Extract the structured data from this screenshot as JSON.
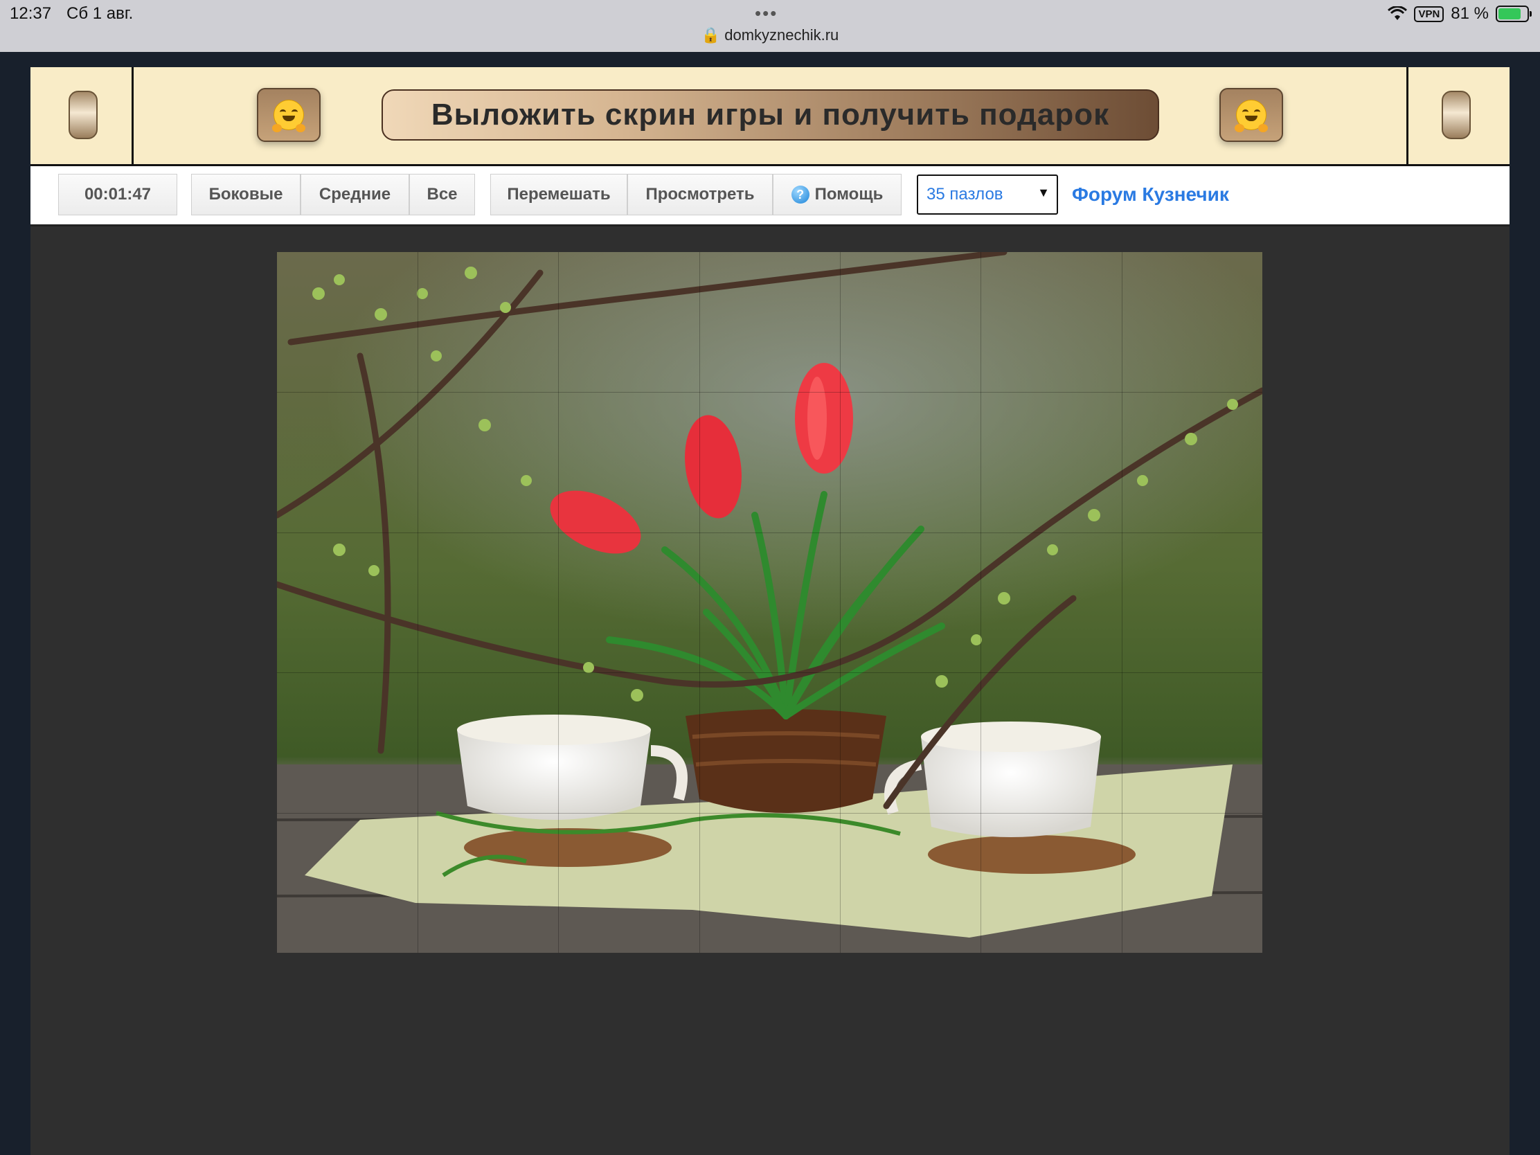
{
  "status_bar": {
    "time": "12:37",
    "date": "Сб 1 авг.",
    "url": "domkyznechik.ru",
    "vpn": "VPN",
    "battery": "81 %"
  },
  "banner": {
    "title": "Выложить скрин игры и получить подарок",
    "emoji": "hugging-face"
  },
  "toolbar": {
    "timer": "00:01:47",
    "filter_buttons": [
      "Боковые",
      "Средние",
      "Все"
    ],
    "action_buttons": [
      "Перемешать",
      "Просмотреть",
      "Помощь"
    ],
    "pieces_select": "35 пазлов",
    "forum_link": "Форум Кузнечик"
  },
  "puzzle": {
    "image": "red tulips in a wooden pot between two white cups on a table with blossoming branches",
    "pieces": 35,
    "columns": 7,
    "rows": 5
  },
  "colors": {
    "banner_bg": "#f9ecc7",
    "link": "#2a7ae2",
    "page_bg": "#2f2f2f"
  }
}
